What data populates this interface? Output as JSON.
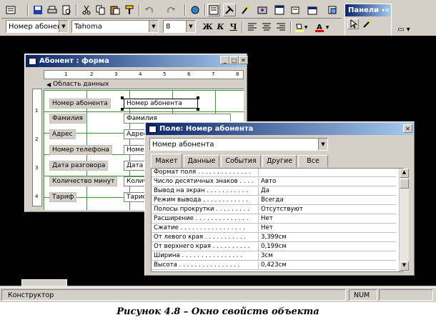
{
  "toolbar": {
    "object_dropdown": "Номер абонен",
    "font_dropdown": "Tahoma",
    "size_dropdown": "8",
    "bold": "Ж",
    "italic": "К",
    "underline": "Ч"
  },
  "toolbox": {
    "title": "Панели"
  },
  "form_window": {
    "title": "Абонент : форма",
    "section": "Область данных",
    "ruler_ticks": [
      "1",
      "2",
      "3",
      "4",
      "5",
      "6",
      "7",
      "8"
    ],
    "vruler_ticks": [
      "1",
      "2",
      "3",
      "4"
    ],
    "labels": [
      "Номер абонента",
      "Фамилия",
      "Адрес",
      "Номер телефона",
      "Дата разговора",
      "Количество минут",
      "Тариф"
    ],
    "fields": [
      "Номер абонента",
      "Фамилия",
      "Адрес",
      "Номер",
      "Дата",
      "Количе",
      "Тариф"
    ]
  },
  "properties": {
    "title": "Поле: Номер абонента",
    "object_select": "Номер абонента",
    "tabs": [
      "Макет",
      "Данные",
      "События",
      "Другие",
      "Все"
    ],
    "rows": [
      {
        "name": "Формат поля . . . . . . . . . . . . . .",
        "value": ""
      },
      {
        "name": "Число десятичных знаков . . . .",
        "value": "Авто"
      },
      {
        "name": "Вывод на экран . . . . . . . . . . .",
        "value": "Да"
      },
      {
        "name": "Режим вывода . . . . . . . . . . . .",
        "value": "Всегда"
      },
      {
        "name": "Полосы прокрутки . . . . . . . . .",
        "value": "Отсутствуют"
      },
      {
        "name": "Расширение . . . . . . . . . . . . . .",
        "value": "Нет"
      },
      {
        "name": "Сжатие . . . . . . . . . . . . . . . . .",
        "value": "Нет"
      },
      {
        "name": "От левого края . . . . . . . . . . .",
        "value": "3,399см"
      },
      {
        "name": "От верхнего края . . . . . . . . . .",
        "value": "0,199см"
      },
      {
        "name": "Ширина . . . . . . . . . . . . . . . .",
        "value": "3см"
      },
      {
        "name": "Высота . . . . . . . . . . . . . . . .",
        "value": "0,423см"
      }
    ]
  },
  "status": {
    "left": "Конструктор",
    "right": "NUM"
  },
  "caption": "Рисунок 4.8 – Окно свойств объекта",
  "colors": {
    "title_bar": "#0a246a",
    "workspace": "#000000",
    "grid": "#3a9a3a"
  }
}
